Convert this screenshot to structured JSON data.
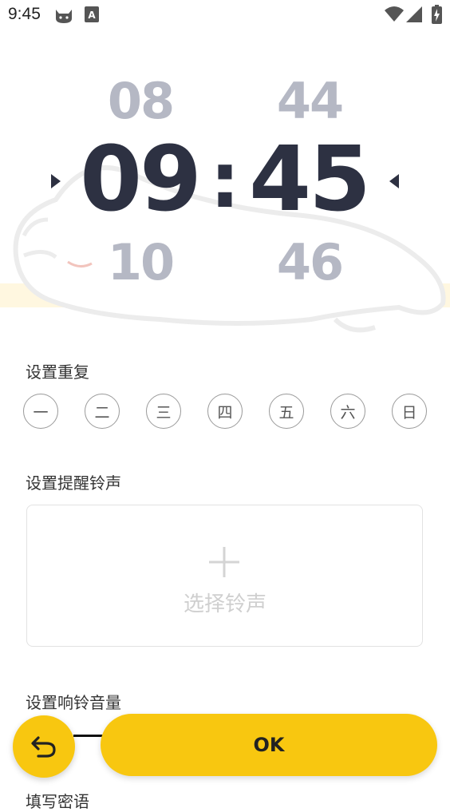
{
  "status_bar": {
    "time": "9:45",
    "icons": [
      "cat-notification-icon",
      "text-a-notification-icon",
      "wifi-icon",
      "signal-icon",
      "battery-charging-icon"
    ]
  },
  "time_picker": {
    "hour_prev": "08",
    "hour_current": "09",
    "hour_next": "10",
    "separator": ":",
    "minute_prev": "44",
    "minute_current": "45",
    "minute_next": "46",
    "accent_color": "#2d3142",
    "faded_color": "#b5b8c4"
  },
  "repeat": {
    "label": "设置重复",
    "days": [
      "一",
      "二",
      "三",
      "四",
      "五",
      "六",
      "日"
    ]
  },
  "ringtone": {
    "label": "设置提醒铃声",
    "choose_text": "选择铃声"
  },
  "volume": {
    "label": "设置响铃音量"
  },
  "password": {
    "label": "填写密语"
  },
  "actions": {
    "ok_label": "OK",
    "button_color": "#f8c710"
  }
}
